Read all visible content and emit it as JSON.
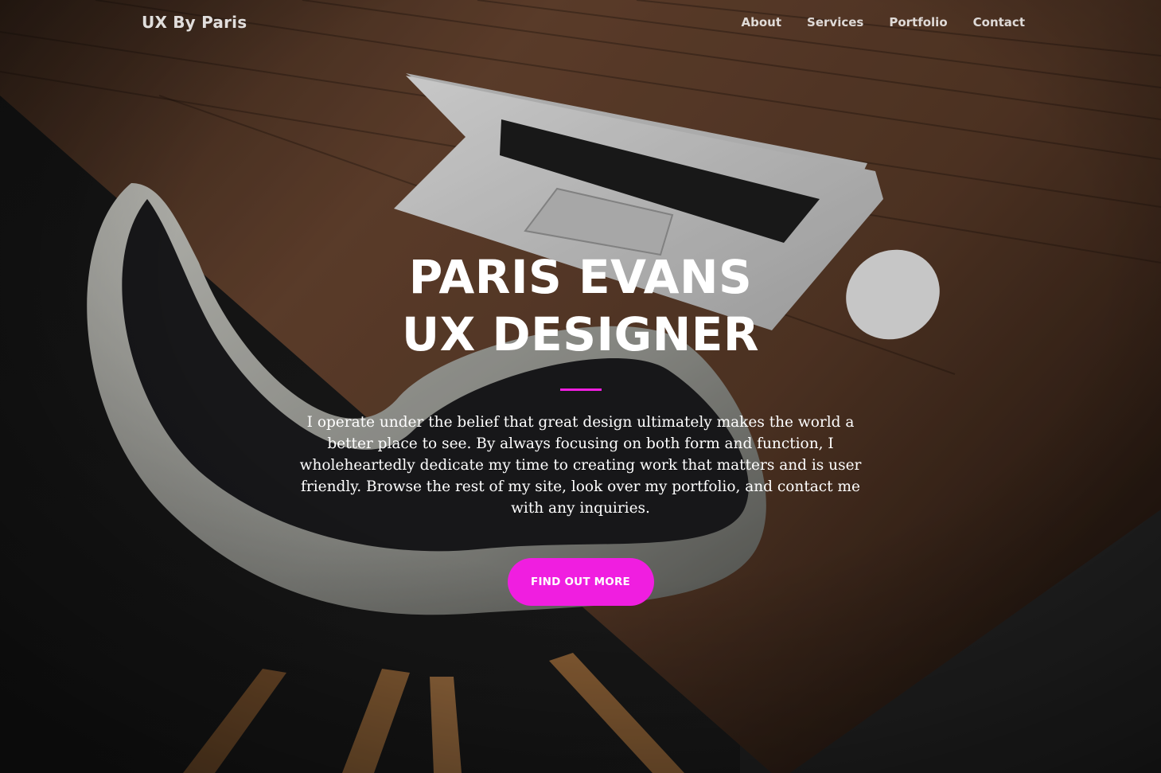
{
  "brand": "UX By Paris",
  "nav": {
    "items": [
      {
        "label": "About"
      },
      {
        "label": "Services"
      },
      {
        "label": "Portfolio"
      },
      {
        "label": "Contact"
      }
    ]
  },
  "hero": {
    "title_line1": "PARIS EVANS",
    "title_line2": "UX DESIGNER",
    "description": "I operate under the belief that great design ultimately makes the world a better place to see. By always focusing on both form and function, I wholeheartedly dedicate my time to creating work that matters and is user friendly. Browse the rest of my site, look over my portfolio, and contact me with any inquiries.",
    "cta_label": "FIND OUT MORE"
  },
  "colors": {
    "accent": "#f01ee0",
    "text": "#ffffff"
  }
}
